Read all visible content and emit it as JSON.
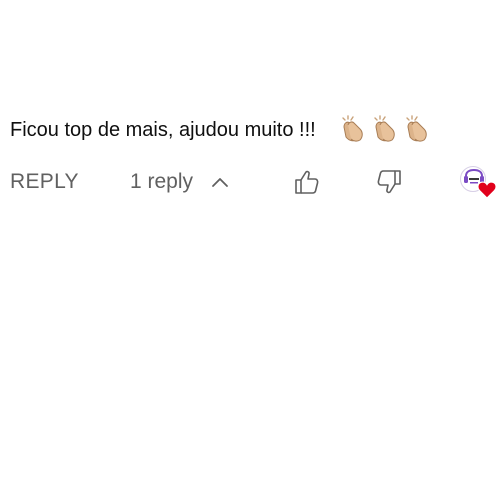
{
  "comment": {
    "text": "Ficou top de mais, ajudou muito !!!",
    "emojis": [
      "clapping-hands",
      "clapping-hands",
      "clapping-hands"
    ]
  },
  "actions": {
    "reply_label": "REPLY",
    "replies_label": "1 reply",
    "expand_icon": "chevron-up-icon",
    "like_icon": "thumbs-up-icon",
    "dislike_icon": "thumbs-down-icon",
    "creator_heart_icon": "heart-icon"
  },
  "colors": {
    "text": "#0f0f0f",
    "secondary_text": "#606060",
    "heart": "#e1001b",
    "avatar_accent": "#7b4bc4"
  }
}
